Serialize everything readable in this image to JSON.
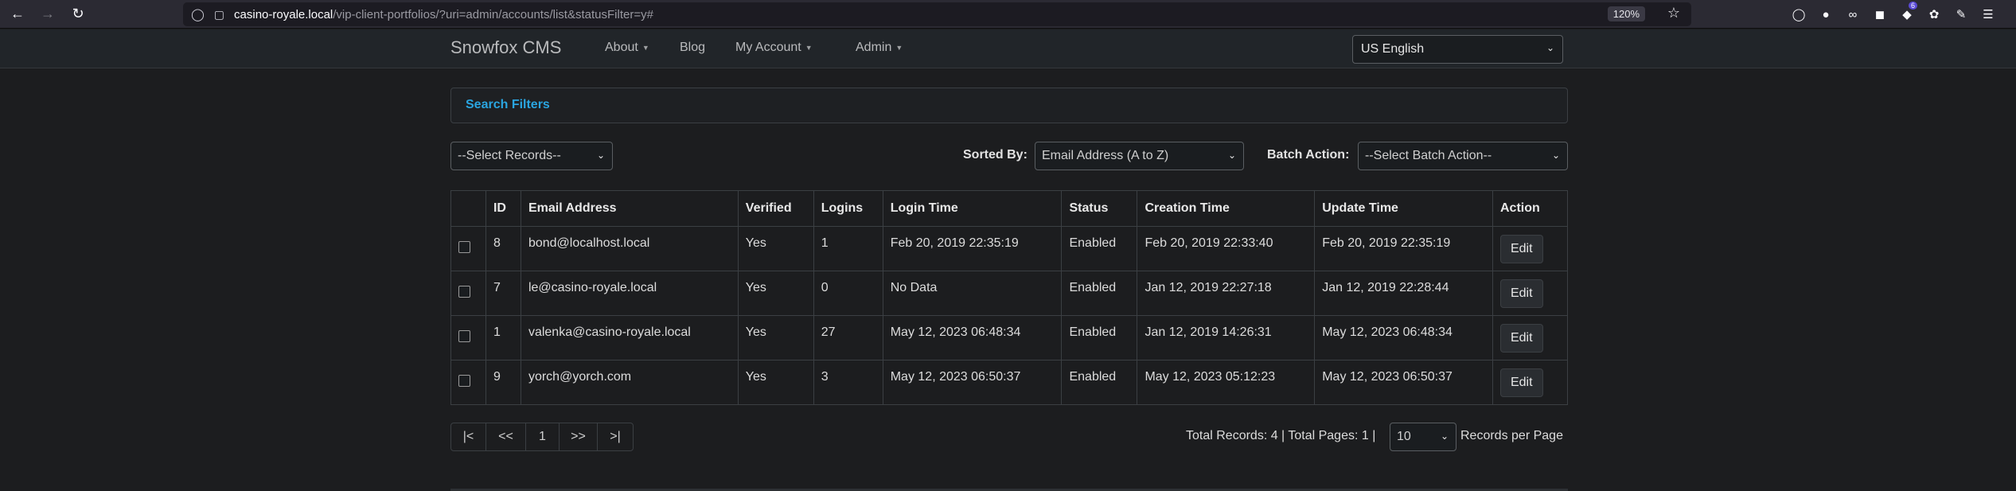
{
  "browser": {
    "url_host": "casino-royale.local",
    "url_path": "/vip-client-portfolios/?uri=admin/accounts/list&statusFilter=y#",
    "zoom": "120%",
    "extension_badge": "6"
  },
  "navbar": {
    "brand": "Snowfox CMS",
    "items": [
      "About",
      "Blog",
      "My Account",
      "Admin"
    ],
    "language": "US English"
  },
  "filters": {
    "title": "Search Filters"
  },
  "controls": {
    "select_records": "--Select Records--",
    "sorted_by_label": "Sorted By:",
    "sorted_by_value": "Email Address (A to Z)",
    "batch_label": "Batch Action:",
    "batch_value": "--Select Batch Action--"
  },
  "table": {
    "headers": [
      "",
      "ID",
      "Email Address",
      "Verified",
      "Logins",
      "Login Time",
      "Status",
      "Creation Time",
      "Update Time",
      "Action"
    ],
    "rows": [
      {
        "id": "8",
        "email": "bond@localhost.local",
        "verified": "Yes",
        "logins": "1",
        "login_time": "Feb 20, 2019 22:35:19",
        "status": "Enabled",
        "created": "Feb 20, 2019 22:33:40",
        "updated": "Feb 20, 2019 22:35:19",
        "action": "Edit"
      },
      {
        "id": "7",
        "email": "le@casino-royale.local",
        "verified": "Yes",
        "logins": "0",
        "login_time": "No Data",
        "status": "Enabled",
        "created": "Jan 12, 2019 22:27:18",
        "updated": "Jan 12, 2019 22:28:44",
        "action": "Edit"
      },
      {
        "id": "1",
        "email": "valenka@casino-royale.local",
        "verified": "Yes",
        "logins": "27",
        "login_time": "May 12, 2023 06:48:34",
        "status": "Enabled",
        "created": "Jan 12, 2019 14:26:31",
        "updated": "May 12, 2023 06:48:34",
        "action": "Edit"
      },
      {
        "id": "9",
        "email": "yorch@yorch.com",
        "verified": "Yes",
        "logins": "3",
        "login_time": "May 12, 2023 06:50:37",
        "status": "Enabled",
        "created": "May 12, 2023 05:12:23",
        "updated": "May 12, 2023 06:50:37",
        "action": "Edit"
      }
    ]
  },
  "pagination": {
    "first": "|<",
    "prev": "<<",
    "current": "1",
    "next": ">>",
    "last": ">|",
    "totals": "Total Records: 4 | Total Pages: 1 |",
    "per_page": "10",
    "per_page_label": "Records per Page"
  }
}
